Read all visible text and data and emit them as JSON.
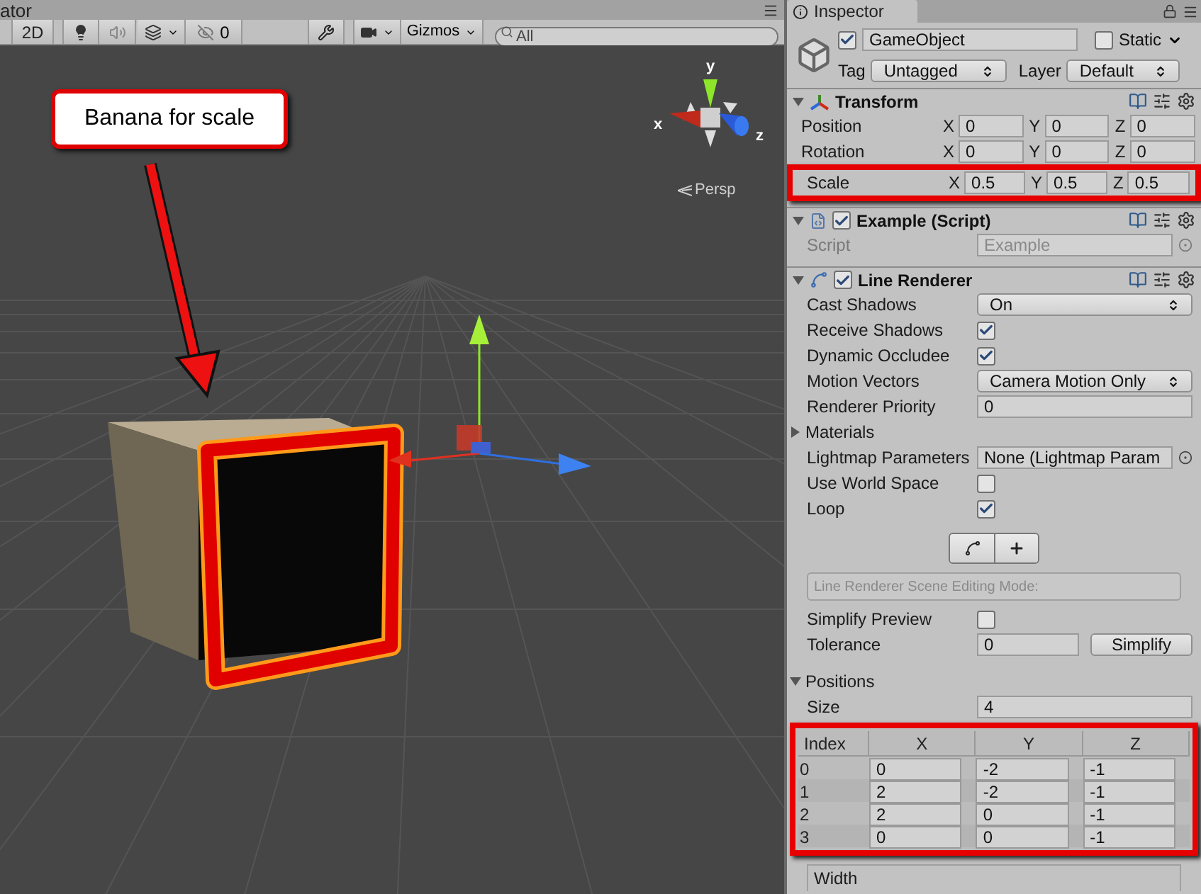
{
  "scene_tab": {
    "title": "ator"
  },
  "scene_toolbar": {
    "mode_2d": {
      "label": "2D",
      "selected": false
    },
    "lighting": {
      "on": true
    },
    "audio": {
      "on": false
    },
    "tools": {
      "on": true
    },
    "hidden_count": "0",
    "gizmos": "Gizmos",
    "search": {
      "placeholder": "All"
    }
  },
  "scene": {
    "callout": "Banana for scale",
    "axis_labels": [
      "x",
      "y",
      "z"
    ],
    "projection": "Persp"
  },
  "inspector": {
    "title": "Inspector",
    "object": {
      "active": true,
      "name": "GameObject",
      "static_label": "Static",
      "static": false,
      "tag_label": "Tag",
      "tag": "Untagged",
      "layer_label": "Layer",
      "layer": "Default"
    },
    "transform": {
      "title": "Transform",
      "expanded": true,
      "rows": [
        {
          "label": "Position",
          "highlighted": false,
          "values": [
            {
              "axis": "X",
              "value": "0"
            },
            {
              "axis": "Y",
              "value": "0"
            },
            {
              "axis": "Z",
              "value": "0"
            }
          ]
        },
        {
          "label": "Rotation",
          "highlighted": false,
          "values": [
            {
              "axis": "X",
              "value": "0"
            },
            {
              "axis": "Y",
              "value": "0"
            },
            {
              "axis": "Z",
              "value": "0"
            }
          ]
        },
        {
          "label": "Scale",
          "highlighted": true,
          "values": [
            {
              "axis": "X",
              "value": "0.5"
            },
            {
              "axis": "Y",
              "value": "0.5"
            },
            {
              "axis": "Z",
              "value": "0.5"
            }
          ]
        }
      ]
    },
    "script": {
      "title": "Example (Script)",
      "expanded": true,
      "enabled": true,
      "label": "Script",
      "value": "Example",
      "disabled": true
    },
    "line_renderer": {
      "title": "Line Renderer",
      "expanded": true,
      "enabled": true,
      "properties": [
        {
          "kind": "dropdown",
          "label": "Cast Shadows",
          "value": "On"
        },
        {
          "kind": "checkbox",
          "label": "Receive Shadows",
          "checked": true
        },
        {
          "kind": "checkbox",
          "label": "Dynamic Occludee",
          "checked": true
        },
        {
          "kind": "dropdown",
          "label": "Motion Vectors",
          "value": "Camera Motion Only"
        },
        {
          "kind": "field",
          "label": "Renderer Priority",
          "value": "0"
        },
        {
          "kind": "foldout",
          "label": "Materials",
          "expanded": false
        },
        {
          "kind": "object",
          "label": "Lightmap Parameters",
          "value": "None (Lightmap Param"
        },
        {
          "kind": "checkbox",
          "label": "Use World Space",
          "checked": false
        },
        {
          "kind": "checkbox",
          "label": "Loop",
          "checked": true
        }
      ],
      "mode_label": "Line Renderer Scene Editing Mode:",
      "editing_properties": [
        {
          "kind": "checkbox",
          "label": "Simplify Preview",
          "checked": false
        },
        {
          "kind": "field_button",
          "label": "Tolerance",
          "value": "0",
          "button": "Simplify"
        }
      ],
      "positions": {
        "label": "Positions",
        "expanded": true,
        "size_label": "Size",
        "size": "4",
        "highlighted": true,
        "columns": [
          "Index",
          "X",
          "Y",
          "Z"
        ],
        "rows": [
          [
            "0",
            "0",
            "-2",
            "-1"
          ],
          [
            "1",
            "2",
            "-2",
            "-1"
          ],
          [
            "2",
            "2",
            "0",
            "-1"
          ],
          [
            "3",
            "0",
            "0",
            "-1"
          ]
        ]
      },
      "width_label": "Width"
    }
  }
}
